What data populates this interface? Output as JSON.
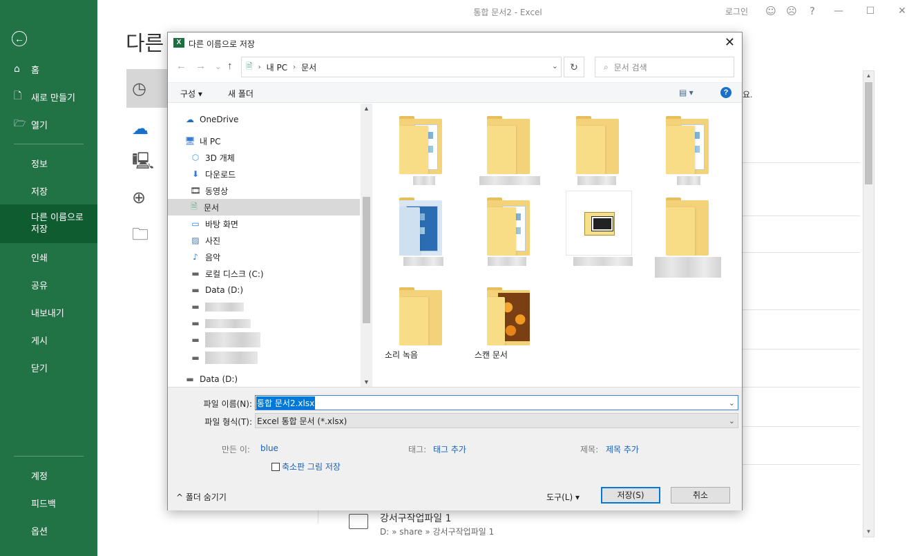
{
  "app": {
    "title": "통합 문서2 - Excel",
    "login": "로그인",
    "smile_icon": "☺",
    "frown_icon": "☹",
    "help_icon": "?",
    "minimize": "—",
    "maximize": "☐",
    "close": "✕"
  },
  "backstage": {
    "back_icon": "←",
    "items": [
      {
        "icon": "⌂",
        "label": "홈"
      },
      {
        "icon": "🗋",
        "label": "새로 만들기"
      },
      {
        "icon": "🗁",
        "label": "열기"
      },
      {
        "label": "정보"
      },
      {
        "label": "저장"
      },
      {
        "label": "다른 이름으로 저장"
      },
      {
        "label": "인쇄"
      },
      {
        "label": "공유"
      },
      {
        "label": "내보내기"
      },
      {
        "label": "게시"
      },
      {
        "label": "닫기"
      },
      {
        "label": "계정"
      },
      {
        "label": "피드백"
      },
      {
        "label": "옵션"
      }
    ],
    "active_line1": "다른 이름으로",
    "active_line2": "저장"
  },
  "main": {
    "heading": "다른 이름으로 저장",
    "right_fragment": "요.",
    "recent_file_name": "강서구작업파일 1",
    "recent_file_path": "D: » share » 강서구작업파일 1"
  },
  "dialog": {
    "title": "다른 이름으로 저장",
    "excel_badge": "X",
    "close": "✕",
    "nav": {
      "back": "←",
      "forward": "→",
      "recent": "⌄",
      "up": "↑"
    },
    "address": {
      "icon": "🗎",
      "parts": [
        "내 PC",
        "문서"
      ],
      "sep": "›",
      "dropdown": "⌄"
    },
    "refresh": "↻",
    "search_placeholder": "문서 검색",
    "search_icon": "⌕",
    "toolbar": {
      "organize": "구성 ▾",
      "new_folder": "새 폴더",
      "view": "▤ ▾",
      "help": "?"
    },
    "tree": [
      {
        "icon": "☁",
        "label": "OneDrive"
      },
      {
        "icon": "🖥",
        "label": "내 PC"
      },
      {
        "icon": "⬡",
        "label": "3D 개체"
      },
      {
        "icon": "⬇",
        "label": "다운로드"
      },
      {
        "icon": "🎞",
        "label": "동영상"
      },
      {
        "icon": "🗎",
        "label": "문서"
      },
      {
        "icon": "▭",
        "label": "바탕 화면"
      },
      {
        "icon": "▨",
        "label": "사진"
      },
      {
        "icon": "♪",
        "label": "음악"
      },
      {
        "icon": "▬",
        "label": "로컬 디스크 (C:)"
      },
      {
        "icon": "▬",
        "label": "Data (D:)"
      },
      {
        "icon": "▬",
        "label": "Data (D:)"
      }
    ],
    "files": [
      {
        "label": "소리 녹음"
      },
      {
        "label": "스캔 문서"
      }
    ],
    "bottom": {
      "filename_label": "파일 이름(N):",
      "filename_value": "통합 문서2.xlsx",
      "filetype_label": "파일 형식(T):",
      "filetype_value": "Excel 통합 문서 (*.xlsx)",
      "author_label": "만든 이:",
      "author_value": "blue",
      "tags_label": "태그:",
      "tags_value": "태그 추가",
      "title_label": "제목:",
      "title_value": "제목 추가",
      "thumbnail_label": "축소판 그림 저장",
      "hide_folders": "^ 폴더 숨기기",
      "tools": "도구(L)  ▾",
      "save": "저장(S)",
      "cancel": "취소"
    }
  }
}
